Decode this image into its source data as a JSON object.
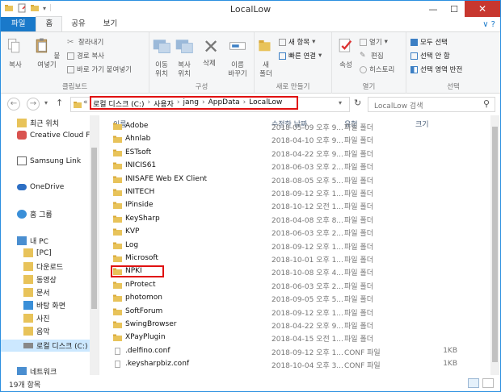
{
  "window": {
    "title": "LocalLow"
  },
  "tabs": [
    "파일",
    "홈",
    "공유",
    "보기"
  ],
  "ribbon": {
    "clipboard": {
      "copy": "복사",
      "paste": "붙여넣기",
      "cut": "잘라내기",
      "copy_path": "경로 복사",
      "paste_shortcut": "바로 가기 붙여넣기",
      "label": "클립보드"
    },
    "organize": {
      "move": "이동\n위치",
      "copy_to": "복사\n위치",
      "delete": "삭제",
      "rename": "이름\n바꾸기",
      "label": "구성"
    },
    "new": {
      "new_folder": "새\n폴더",
      "new_item": "새 항목",
      "easy_access": "빠른 연결",
      "label": "새로 만들기"
    },
    "open": {
      "properties": "속성",
      "open": "열기",
      "edit": "편집",
      "history": "히스토리",
      "label": "열기"
    },
    "select": {
      "select_all": "모두 선택",
      "select_none": "선택 안 함",
      "invert": "선택 영역 반전",
      "label": "선택"
    }
  },
  "address": {
    "crumbs": [
      "로컬 디스크 (C:)",
      "사용자",
      "jang",
      "AppData",
      "LocalLow"
    ],
    "prefix": "«",
    "search_placeholder": "LocalLow 검색"
  },
  "nav": [
    {
      "label": "최근 위치",
      "icon": "recent-icon"
    },
    {
      "label": "Creative Cloud Fi",
      "icon": "cloud-icon"
    },
    {
      "label": "Samsung Link",
      "icon": "link-icon"
    },
    {
      "label": "OneDrive",
      "icon": "onedrive-icon"
    },
    {
      "label": "홈 그룹",
      "icon": "homegroup-icon"
    },
    {
      "label": "내 PC",
      "icon": "pc-icon"
    },
    {
      "label": "[PC]",
      "icon": "folder-icon"
    },
    {
      "label": "다운로드",
      "icon": "download-icon"
    },
    {
      "label": "동영상",
      "icon": "video-icon"
    },
    {
      "label": "문서",
      "icon": "document-icon"
    },
    {
      "label": "바탕 화면",
      "icon": "desktop-icon"
    },
    {
      "label": "사진",
      "icon": "picture-icon"
    },
    {
      "label": "음악",
      "icon": "music-icon"
    },
    {
      "label": "로컬 디스크 (C:)",
      "icon": "drive-icon"
    },
    {
      "label": "네트워크",
      "icon": "network-icon"
    }
  ],
  "columns": {
    "name": "이름",
    "date": "수정한 날짜",
    "type": "유형",
    "size": "크기"
  },
  "files": [
    {
      "name": "Adobe",
      "date": "2018-05-09 오후 9...",
      "type": "파일 폴더",
      "size": ""
    },
    {
      "name": "Ahnlab",
      "date": "2018-04-10 오후 9...",
      "type": "파일 폴더",
      "size": ""
    },
    {
      "name": "ESTsoft",
      "date": "2018-04-22 오후 9...",
      "type": "파일 폴더",
      "size": ""
    },
    {
      "name": "INICIS61",
      "date": "2018-06-03 오후 2...",
      "type": "파일 폴더",
      "size": ""
    },
    {
      "name": "INISAFE Web EX Client",
      "date": "2018-08-05 오후 5...",
      "type": "파일 폴더",
      "size": ""
    },
    {
      "name": "INITECH",
      "date": "2018-09-12 오후 1...",
      "type": "파일 폴더",
      "size": ""
    },
    {
      "name": "IPinside",
      "date": "2018-10-12 오전 1...",
      "type": "파일 폴더",
      "size": ""
    },
    {
      "name": "KeySharp",
      "date": "2018-04-08 오후 8...",
      "type": "파일 폴더",
      "size": ""
    },
    {
      "name": "KVP",
      "date": "2018-06-03 오후 2...",
      "type": "파일 폴더",
      "size": ""
    },
    {
      "name": "Log",
      "date": "2018-09-12 오후 1...",
      "type": "파일 폴더",
      "size": ""
    },
    {
      "name": "Microsoft",
      "date": "2018-10-01 오후 1...",
      "type": "파일 폴더",
      "size": ""
    },
    {
      "name": "NPKI",
      "date": "2018-10-08 오후 4...",
      "type": "파일 폴더",
      "size": ""
    },
    {
      "name": "nProtect",
      "date": "2018-06-03 오후 2...",
      "type": "파일 폴더",
      "size": ""
    },
    {
      "name": "photomon",
      "date": "2018-09-05 오후 5...",
      "type": "파일 폴더",
      "size": ""
    },
    {
      "name": "SoftForum",
      "date": "2018-09-12 오후 1...",
      "type": "파일 폴더",
      "size": ""
    },
    {
      "name": "SwingBrowser",
      "date": "2018-04-22 오후 9...",
      "type": "파일 폴더",
      "size": ""
    },
    {
      "name": "XPayPlugin",
      "date": "2018-04-15 오전 1...",
      "type": "파일 폴더",
      "size": ""
    },
    {
      "name": ".delfino.conf",
      "date": "2018-09-12 오후 1...",
      "type": "CONF 파일",
      "size": "1KB"
    },
    {
      "name": ".keysharpbiz.conf",
      "date": "2018-10-04 오후 3...",
      "type": "CONF 파일",
      "size": "1KB"
    }
  ],
  "status": {
    "count": "19개 항목"
  },
  "colors": {
    "accent": "#1979ca",
    "highlight": "#e01010",
    "selection": "#cce8ff",
    "folder": "#e8c35a"
  }
}
